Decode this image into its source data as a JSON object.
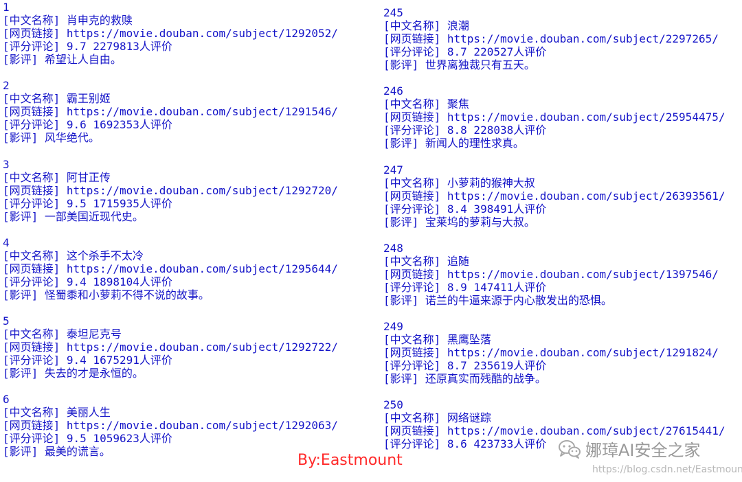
{
  "left_column": [
    {
      "index": "1",
      "name": "[中文名称] 肖申克的救赎",
      "link": "[网页链接] https://movie.douban.com/subject/1292052/",
      "rating": "[评分评论] 9.7  2279813人评价",
      "review": "[影评] 希望让人自由。"
    },
    {
      "index": "2",
      "name": "[中文名称] 霸王别姬",
      "link": "[网页链接] https://movie.douban.com/subject/1291546/",
      "rating": "[评分评论] 9.6  1692353人评价",
      "review": "[影评] 风华绝代。"
    },
    {
      "index": "3",
      "name": "[中文名称] 阿甘正传",
      "link": "[网页链接] https://movie.douban.com/subject/1292720/",
      "rating": "[评分评论] 9.5  1715935人评价",
      "review": "[影评] 一部美国近现代史。"
    },
    {
      "index": "4",
      "name": "[中文名称] 这个杀手不太冷",
      "link": "[网页链接] https://movie.douban.com/subject/1295644/",
      "rating": "[评分评论] 9.4  1898104人评价",
      "review": "[影评] 怪蜀黍和小萝莉不得不说的故事。"
    },
    {
      "index": "5",
      "name": "[中文名称] 泰坦尼克号",
      "link": "[网页链接] https://movie.douban.com/subject/1292722/",
      "rating": "[评分评论] 9.4  1675291人评价",
      "review": "[影评] 失去的才是永恒的。"
    },
    {
      "index": "6",
      "name": "[中文名称] 美丽人生",
      "link": "[网页链接] https://movie.douban.com/subject/1292063/",
      "rating": "[评分评论] 9.5  1059623人评价",
      "review": "[影评] 最美的谎言。"
    }
  ],
  "right_column": [
    {
      "index": "245",
      "name": "[中文名称] 浪潮",
      "link": "[网页链接] https://movie.douban.com/subject/2297265/",
      "rating": "[评分评论] 8.7  220527人评价",
      "review": "[影评] 世界离独裁只有五天。"
    },
    {
      "index": "246",
      "name": "[中文名称] 聚焦",
      "link": "[网页链接] https://movie.douban.com/subject/25954475/",
      "rating": "[评分评论] 8.8  228038人评价",
      "review": "[影评] 新闻人的理性求真。"
    },
    {
      "index": "247",
      "name": "[中文名称] 小萝莉的猴神大叔",
      "link": "[网页链接] https://movie.douban.com/subject/26393561/",
      "rating": "[评分评论] 8.4  398491人评价",
      "review": "[影评] 宝莱坞的萝莉与大叔。"
    },
    {
      "index": "248",
      "name": "[中文名称] 追随",
      "link": "[网页链接] https://movie.douban.com/subject/1397546/",
      "rating": "[评分评论] 8.9  147411人评价",
      "review": "[影评] 诺兰的牛逼来源于内心散发出的恐惧。"
    },
    {
      "index": "249",
      "name": "[中文名称] 黑鹰坠落",
      "link": "[网页链接] https://movie.douban.com/subject/1291824/",
      "rating": "[评分评论] 8.7  235619人评价",
      "review": "[影评] 还原真实而残酷的战争。"
    },
    {
      "index": "250",
      "name": "[中文名称] 网络谜踪",
      "link": "[网页链接] https://movie.douban.com/subject/27615441/",
      "rating": "[评分评论] 8.6  423733人评价",
      "review": ""
    }
  ],
  "byline": "By:Eastmount",
  "watermark": {
    "name": "娜璋AI安全之家",
    "url": "https://blog.csdn.net/Eastmount",
    "icon": "wechat-icon"
  },
  "colors": {
    "text": "#1414c8",
    "byline": "#ff2a2a",
    "watermark": "#9a9a9a"
  }
}
